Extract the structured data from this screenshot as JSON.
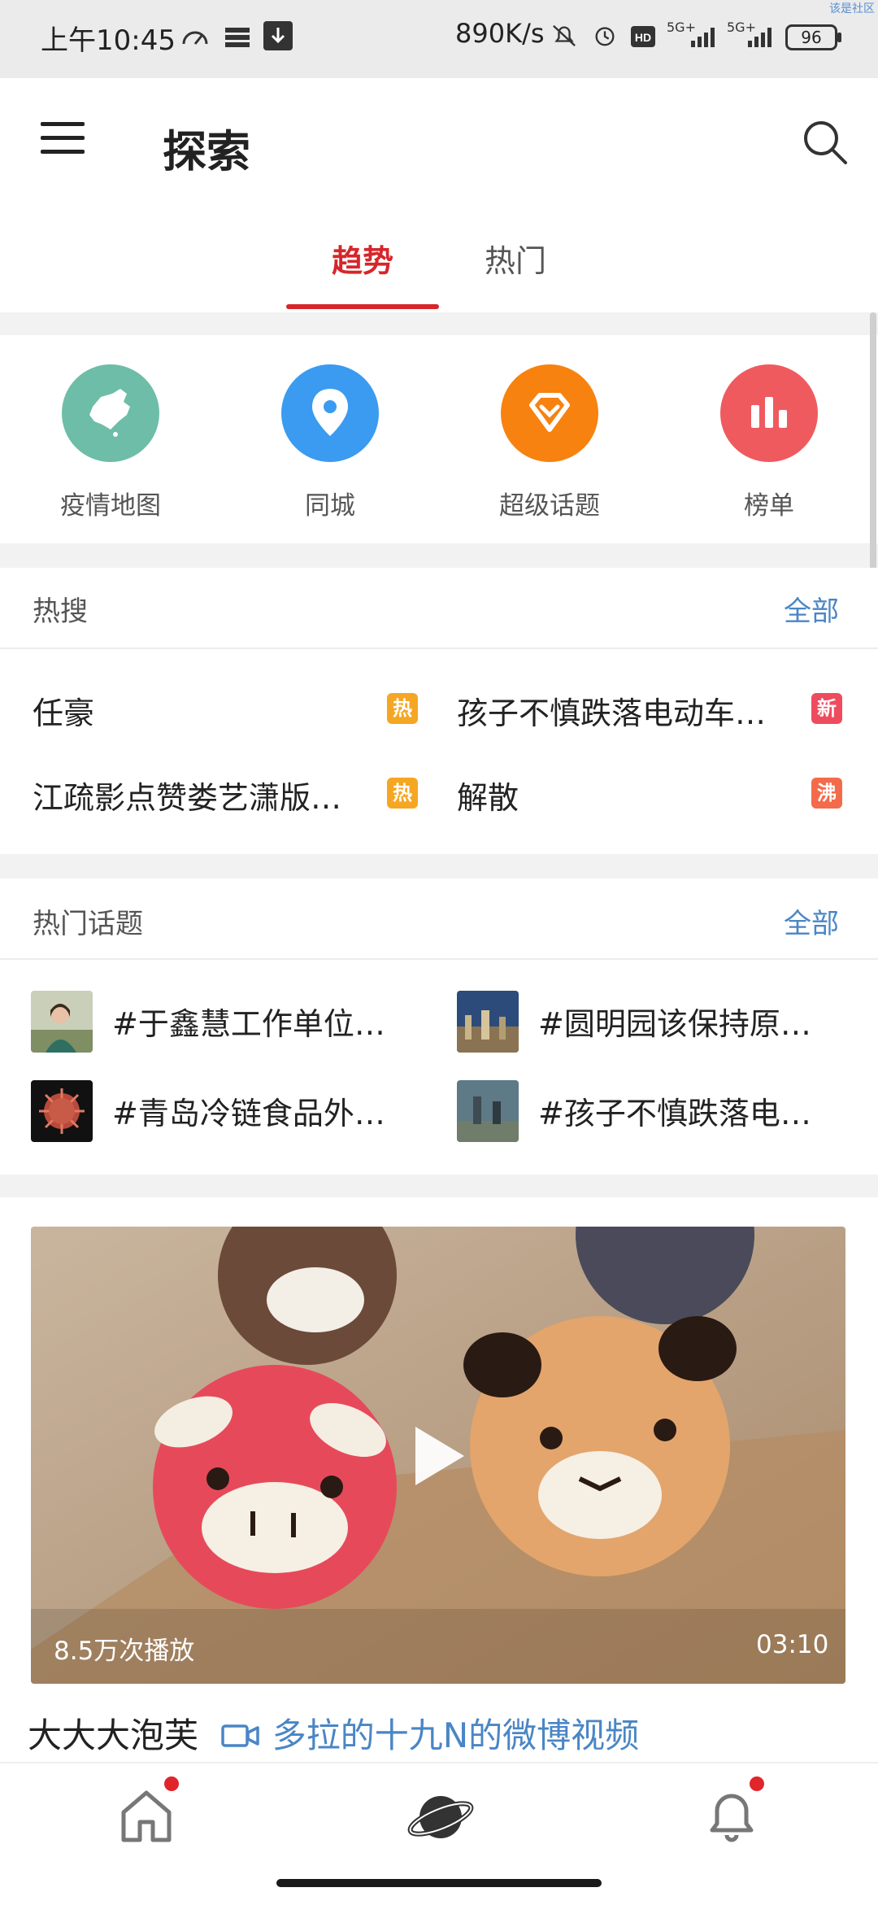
{
  "status_bar": {
    "time": "上午10:45",
    "network_speed": "890K/s",
    "signal_1": "5G+",
    "signal_2": "5G+",
    "battery": "96",
    "watermark": "该是社区"
  },
  "app_bar": {
    "title": "探索",
    "tabs": [
      {
        "label": "趋势",
        "active": true
      },
      {
        "label": "热门",
        "active": false
      }
    ]
  },
  "quick_links": [
    {
      "label": "疫情地图",
      "icon": "china-map-icon",
      "color": "#6dbda8"
    },
    {
      "label": "同城",
      "icon": "location-pin-icon",
      "color": "#3a9bf0"
    },
    {
      "label": "超级话题",
      "icon": "diamond-icon",
      "color": "#f7820f"
    },
    {
      "label": "榜单",
      "icon": "bar-chart-icon",
      "color": "#ef5a5f"
    }
  ],
  "hot_search": {
    "title": "热搜",
    "more_label": "全部",
    "items": [
      {
        "text": "任豪",
        "badge": "热"
      },
      {
        "text": "孩子不慎跌落电动车…",
        "badge": "新"
      },
      {
        "text": "江疏影点赞娄艺潇版…",
        "badge": "热"
      },
      {
        "text": "解散",
        "badge": "沸"
      }
    ]
  },
  "hot_topics": {
    "title": "热门话题",
    "more_label": "全部",
    "items": [
      {
        "text": "#于鑫慧工作单位…"
      },
      {
        "text": "#圆明园该保持原…"
      },
      {
        "text": "#青岛冷链食品外…"
      },
      {
        "text": "#孩子不慎跌落电…"
      }
    ]
  },
  "video_card": {
    "play_count": "8.5万次播放",
    "duration": "03:10",
    "caption": "大大大泡芙",
    "source": "多拉的十九N的微博视频"
  },
  "colors": {
    "accent_red": "#d6262b",
    "link_blue": "#4a86c5"
  }
}
